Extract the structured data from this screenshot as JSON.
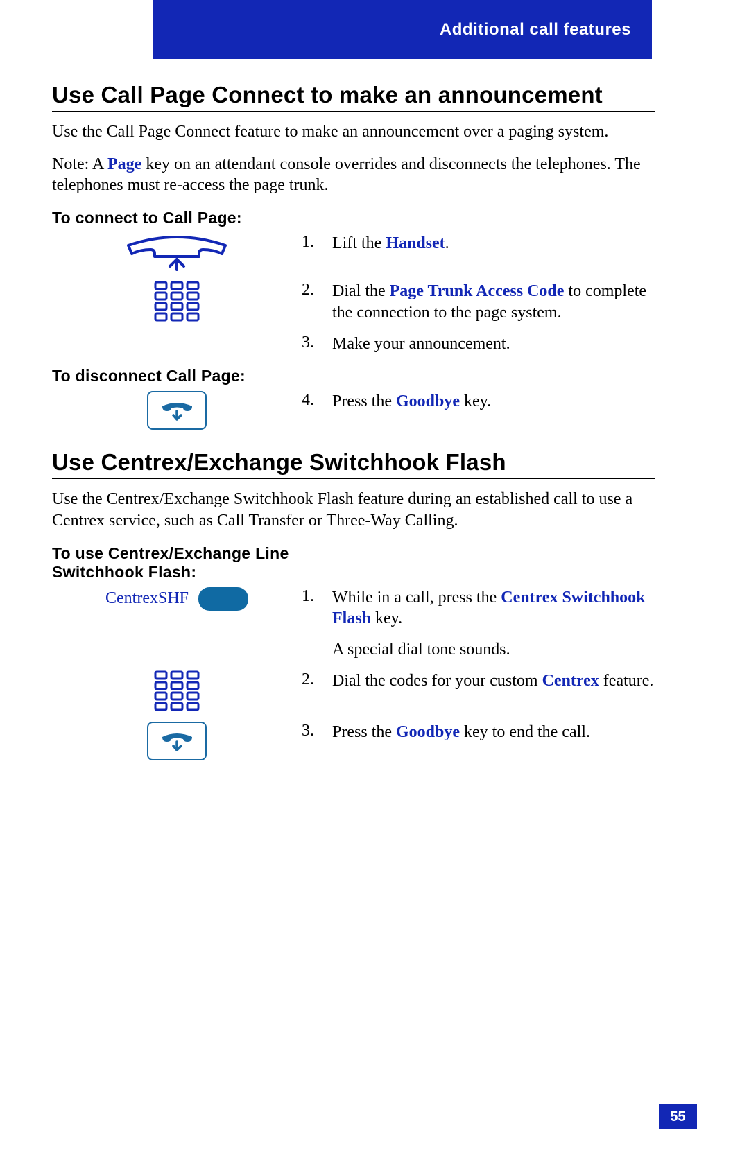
{
  "header": {
    "title": "Additional call features"
  },
  "page_number": "55",
  "section1": {
    "title": "Use Call Page Connect to make an announcement",
    "intro": "Use the Call Page Connect feature to make an announcement over a paging system.",
    "note_prefix": "Note: A ",
    "note_term": "Page",
    "note_suffix": " key on an attendant console overrides and disconnects the telephones. The telephones must re-access the page trunk.",
    "sub1": "To connect to Call Page:",
    "steps1": {
      "s1": {
        "n": "1.",
        "a": "Lift the ",
        "b": "Handset",
        "c": "."
      },
      "s2": {
        "n": "2.",
        "a": "Dial the ",
        "b": "Page Trunk Access Code",
        "c": " to complete the connection to the page system."
      },
      "s3": {
        "n": "3.",
        "a": "Make your announcement."
      }
    },
    "sub2": "To disconnect Call Page:",
    "steps2": {
      "s4": {
        "n": "4.",
        "a": "Press the ",
        "b": "Goodbye",
        "c": " key."
      }
    }
  },
  "section2": {
    "title": "Use Centrex/Exchange Switchhook Flash",
    "intro": "Use the Centrex/Exchange Switchhook Flash feature during an established call to use a Centrex service, such as Call Transfer or Three-Way Calling.",
    "sub": "To use Centrex/Exchange Line Switchhook Flash:",
    "key_label": "CentrexSHF",
    "steps": {
      "s1": {
        "n": "1.",
        "a": "While in a call, press the ",
        "b": "Centrex Switchhook Flash",
        "c": " key.",
        "d": "A special dial tone sounds."
      },
      "s2": {
        "n": "2.",
        "a": "Dial the codes for your custom ",
        "b": "Centrex",
        "c": " feature."
      },
      "s3": {
        "n": "3.",
        "a": "Press the ",
        "b": "Goodbye",
        "c": " key to end the call."
      }
    }
  }
}
